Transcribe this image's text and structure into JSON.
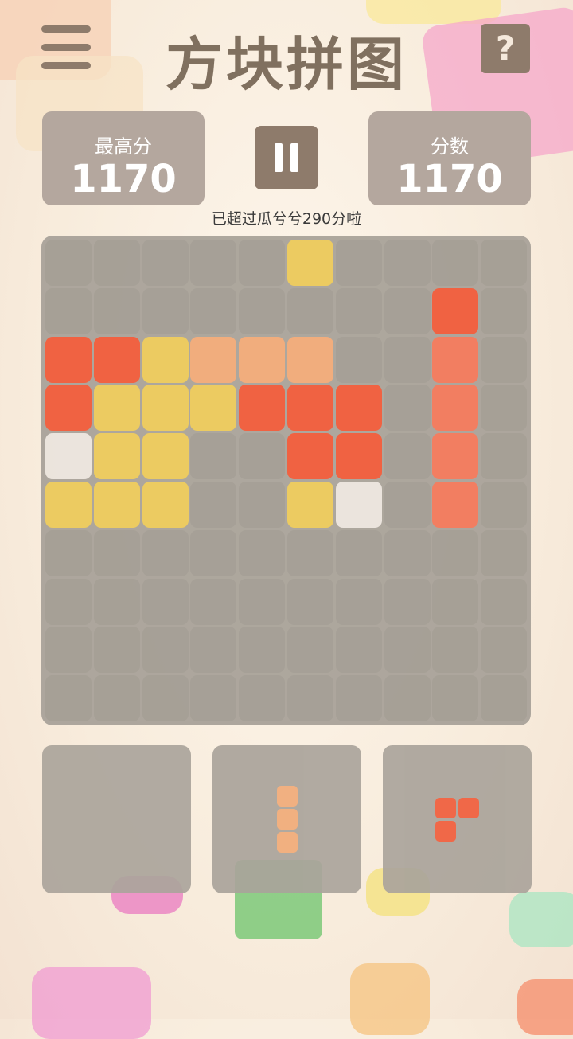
{
  "header": {
    "title": "方块拼图",
    "help_label": "?"
  },
  "scores": {
    "best_label": "最高分",
    "best_value": "1170",
    "current_label": "分数",
    "current_value": "1170"
  },
  "tagline": "已超过瓜兮兮290分啦",
  "colors": {
    "red": "#f05d3c",
    "salmon": "#f27a5c",
    "peach": "#f1ab79",
    "yellow": "#ecca5c",
    "white": "#ebe4dd",
    "empty": "#a39d94"
  },
  "board": {
    "rows": 10,
    "cols": 10,
    "grid": [
      "..........",
      "..........",
      "RRYPPP..S.",
      "RYYYRRR.S.",
      "WYY..RR.S.",
      "YYY..YW.S.",
      "..........",
      "..........",
      "..........",
      ".........."
    ],
    "filled_cells": [
      {
        "row": 0,
        "col": 5,
        "color": "yellow"
      },
      {
        "row": 1,
        "col": 8,
        "color": "red"
      },
      {
        "row": 2,
        "col": 0,
        "color": "red"
      },
      {
        "row": 2,
        "col": 1,
        "color": "red"
      },
      {
        "row": 2,
        "col": 2,
        "color": "yellow"
      },
      {
        "row": 2,
        "col": 3,
        "color": "peach"
      },
      {
        "row": 2,
        "col": 4,
        "color": "peach"
      },
      {
        "row": 2,
        "col": 5,
        "color": "peach"
      },
      {
        "row": 2,
        "col": 8,
        "color": "salmon"
      },
      {
        "row": 3,
        "col": 0,
        "color": "red"
      },
      {
        "row": 3,
        "col": 1,
        "color": "yellow"
      },
      {
        "row": 3,
        "col": 2,
        "color": "yellow"
      },
      {
        "row": 3,
        "col": 3,
        "color": "yellow"
      },
      {
        "row": 3,
        "col": 4,
        "color": "red"
      },
      {
        "row": 3,
        "col": 5,
        "color": "red"
      },
      {
        "row": 3,
        "col": 6,
        "color": "red"
      },
      {
        "row": 3,
        "col": 8,
        "color": "salmon"
      },
      {
        "row": 4,
        "col": 0,
        "color": "white"
      },
      {
        "row": 4,
        "col": 1,
        "color": "yellow"
      },
      {
        "row": 4,
        "col": 2,
        "color": "yellow"
      },
      {
        "row": 4,
        "col": 5,
        "color": "red"
      },
      {
        "row": 4,
        "col": 6,
        "color": "red"
      },
      {
        "row": 4,
        "col": 8,
        "color": "salmon"
      },
      {
        "row": 5,
        "col": 0,
        "color": "yellow"
      },
      {
        "row": 5,
        "col": 1,
        "color": "yellow"
      },
      {
        "row": 5,
        "col": 2,
        "color": "yellow"
      },
      {
        "row": 5,
        "col": 5,
        "color": "yellow"
      },
      {
        "row": 5,
        "col": 6,
        "color": "white"
      },
      {
        "row": 5,
        "col": 8,
        "color": "salmon"
      }
    ]
  },
  "pieces": [
    {
      "slot": 1,
      "color": "none",
      "cells": []
    },
    {
      "slot": 2,
      "color": "peach",
      "cells": [
        [
          0,
          0
        ],
        [
          1,
          0
        ],
        [
          2,
          0
        ]
      ]
    },
    {
      "slot": 3,
      "color": "red",
      "cells": [
        [
          0,
          0
        ],
        [
          0,
          1
        ],
        [
          1,
          0
        ]
      ]
    }
  ]
}
